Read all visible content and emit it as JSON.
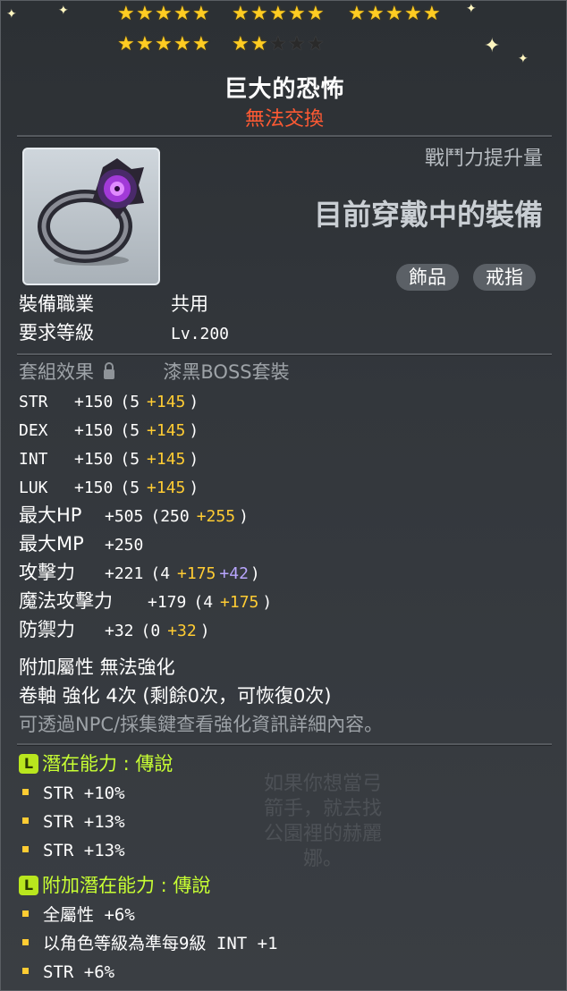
{
  "star_force": {
    "filled": 22,
    "total": 25
  },
  "item": {
    "name": "巨大的恐怖",
    "trade_status": "無法交換",
    "combat_power_label": "戰鬥力提升量",
    "equipped_label": "目前穿戴中的裝備",
    "tags": [
      "飾品",
      "戒指"
    ],
    "icon": "ring-icon"
  },
  "requirements": {
    "job_label": "裝備職業",
    "job_value": "共用",
    "level_label": "要求等級",
    "level_value": "Lv.200"
  },
  "set": {
    "label": "套組效果",
    "value": "漆黑BOSS套裝",
    "icon": "lock-icon"
  },
  "stats": [
    {
      "name": "STR",
      "total": "+150",
      "base": "(5",
      "bonus": "+145",
      "extra": "",
      "close": ")"
    },
    {
      "name": "DEX",
      "total": "+150",
      "base": "(5",
      "bonus": "+145",
      "extra": "",
      "close": ")"
    },
    {
      "name": "INT",
      "total": "+150",
      "base": "(5",
      "bonus": "+145",
      "extra": "",
      "close": ")"
    },
    {
      "name": "LUK",
      "total": "+150",
      "base": "(5",
      "bonus": "+145",
      "extra": "",
      "close": ")"
    },
    {
      "name": "最大HP",
      "total": "+505",
      "base": "(250",
      "bonus": "+255",
      "extra": "",
      "close": ")"
    },
    {
      "name": "最大MP",
      "total": "+250",
      "base": "",
      "bonus": "",
      "extra": "",
      "close": ""
    },
    {
      "name": "攻擊力",
      "total": "+221",
      "base": "(4",
      "bonus": "+175",
      "extra": "+42",
      "close": ")"
    },
    {
      "name": "魔法攻擊力",
      "total": "+179",
      "base": "(4",
      "bonus": "+175",
      "extra": "",
      "close": ")"
    },
    {
      "name": "防禦力",
      "total": "+32",
      "base": "(0",
      "bonus": "+32",
      "extra": "",
      "close": ")"
    }
  ],
  "enhance": {
    "additional": "附加屬性 無法強化",
    "scroll": "卷軸 強化 4次 (剩餘0次，可恢復0次)",
    "hint": "可透過NPC/採集鍵查看強化資訊詳細內容。"
  },
  "potential": {
    "badge": "L",
    "title": "潛在能力 : 傳說",
    "lines": [
      "STR +10%",
      "STR +13%",
      "STR +13%"
    ]
  },
  "additional_potential": {
    "badge": "L",
    "title": "附加潛在能力 : 傳說",
    "lines": [
      "全屬性 +6%",
      "以角色等級為準每9級 INT +1",
      "STR +6%"
    ]
  },
  "colors": {
    "gold": "#ffcc33",
    "red": "#ff5a33",
    "legendary": "#c8ff33",
    "purple": "#b9a6ff"
  }
}
